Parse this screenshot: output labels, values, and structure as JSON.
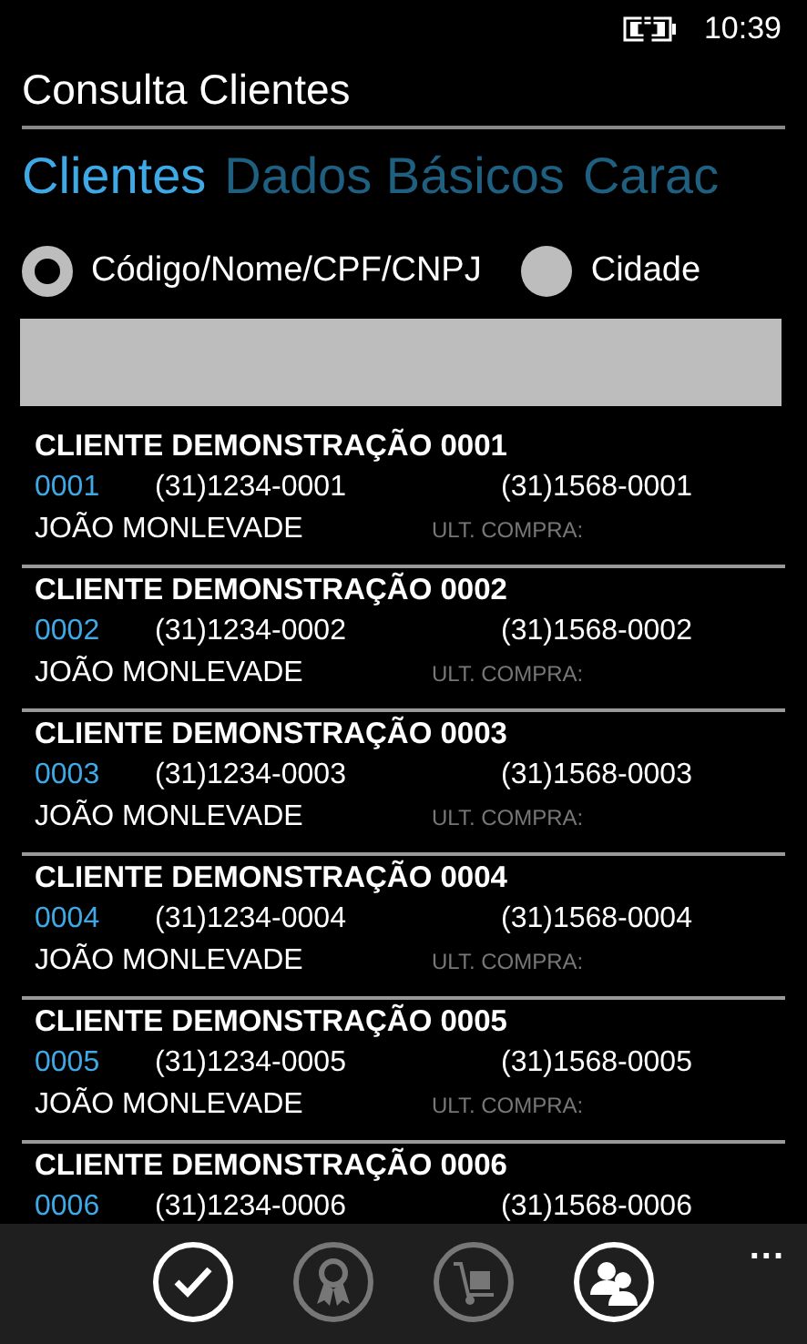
{
  "status_bar": {
    "time": "10:39",
    "charging": true
  },
  "title": "Consulta Clientes",
  "pivot": [
    {
      "label": "Clientes",
      "selected": true
    },
    {
      "label": "Dados Básicos",
      "selected": false
    },
    {
      "label": "Carac",
      "selected": false
    }
  ],
  "search_modes": [
    {
      "label": "Código/Nome/CPF/CNPJ",
      "selected": true
    },
    {
      "label": "Cidade",
      "selected": false
    }
  ],
  "clients": [
    {
      "name": "CLIENTE DEMONSTRAÇÃO 0001",
      "code": "0001",
      "phone_1": "(31)1234-0001",
      "phone_2": "(31)1568-0001",
      "city": "JOÃO MONLEVADE",
      "last_purchase_label": "ULT. COMPRA:"
    },
    {
      "name": "CLIENTE DEMONSTRAÇÃO 0002",
      "code": "0002",
      "phone_1": "(31)1234-0002",
      "phone_2": "(31)1568-0002",
      "city": "JOÃO MONLEVADE",
      "last_purchase_label": "ULT. COMPRA:"
    },
    {
      "name": "CLIENTE DEMONSTRAÇÃO 0003",
      "code": "0003",
      "phone_1": "(31)1234-0003",
      "phone_2": "(31)1568-0003",
      "city": "JOÃO MONLEVADE",
      "last_purchase_label": "ULT. COMPRA:"
    },
    {
      "name": "CLIENTE DEMONSTRAÇÃO 0004",
      "code": "0004",
      "phone_1": "(31)1234-0004",
      "phone_2": "(31)1568-0004",
      "city": "JOÃO MONLEVADE",
      "last_purchase_label": "ULT. COMPRA:"
    },
    {
      "name": "CLIENTE DEMONSTRAÇÃO 0005",
      "code": "0005",
      "phone_1": "(31)1234-0005",
      "phone_2": "(31)1568-0005",
      "city": "JOÃO MONLEVADE",
      "last_purchase_label": "ULT. COMPRA:"
    },
    {
      "name": "CLIENTE DEMONSTRAÇÃO 0006",
      "code": "0006",
      "phone_1": "(31)1234-0006",
      "phone_2": "(31)1568-0006"
    }
  ],
  "app_bar": {
    "buttons": [
      {
        "kind": "check",
        "disabled": false
      },
      {
        "kind": "award",
        "disabled": true
      },
      {
        "kind": "cart",
        "disabled": true
      },
      {
        "kind": "people",
        "disabled": false
      }
    ],
    "more": "..."
  }
}
